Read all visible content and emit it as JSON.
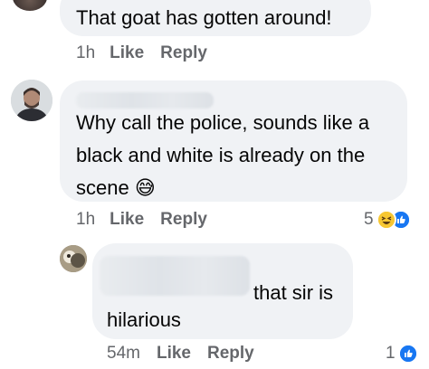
{
  "comments": [
    {
      "text": "That goat has gotten around!",
      "time": "1h",
      "like_label": "Like",
      "reply_label": "Reply"
    },
    {
      "text": "Why call the police, sounds like a\nblack and white is already on the\nscene",
      "emoji": "😅",
      "time": "1h",
      "like_label": "Like",
      "reply_label": "Reply",
      "reaction_count": "5",
      "reaction_icons": [
        "haha-icon",
        "like-icon"
      ]
    },
    {
      "text_line1": "that sir is",
      "text_line2": "hilarious",
      "time": "54m",
      "like_label": "Like",
      "reply_label": "Reply",
      "reaction_count": "1",
      "reaction_icons": [
        "like-icon"
      ]
    }
  ],
  "colors": {
    "bubble": "#f0f2f5",
    "meta": "#65676b",
    "like_blue": "#1877f2",
    "haha_yellow": "#f7c733"
  }
}
